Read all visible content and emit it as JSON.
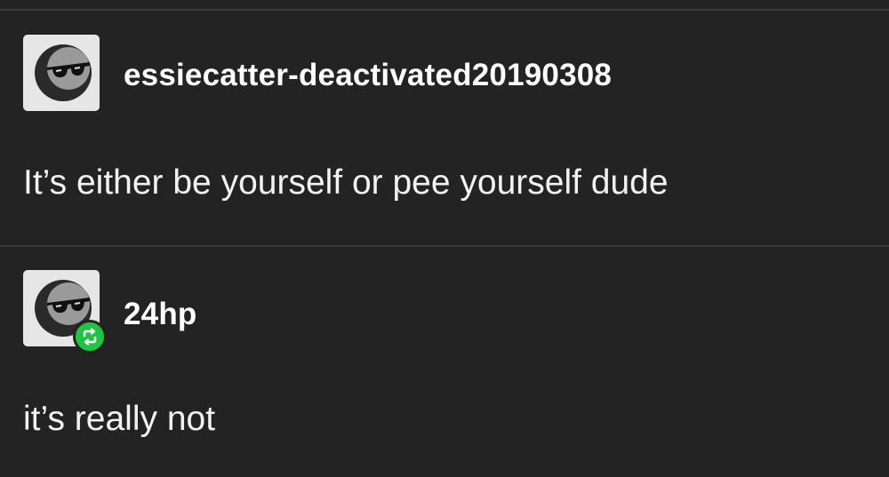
{
  "posts": [
    {
      "username": "essiecatter-deactivated20190308",
      "avatar_icon": "moon-sunglasses-avatar",
      "text": "It’s either be yourself or pee yourself dude",
      "reblogged": false
    },
    {
      "username": "24hp",
      "avatar_icon": "moon-sunglasses-avatar",
      "text": "it’s really not",
      "reblogged": true,
      "badge_icon": "reblog-icon"
    }
  ],
  "colors": {
    "background": "#232323",
    "divider": "#3b3b3b",
    "text": "#ffffff",
    "avatar_bg": "#e6e6e6",
    "reblog_badge": "#1fc541"
  }
}
